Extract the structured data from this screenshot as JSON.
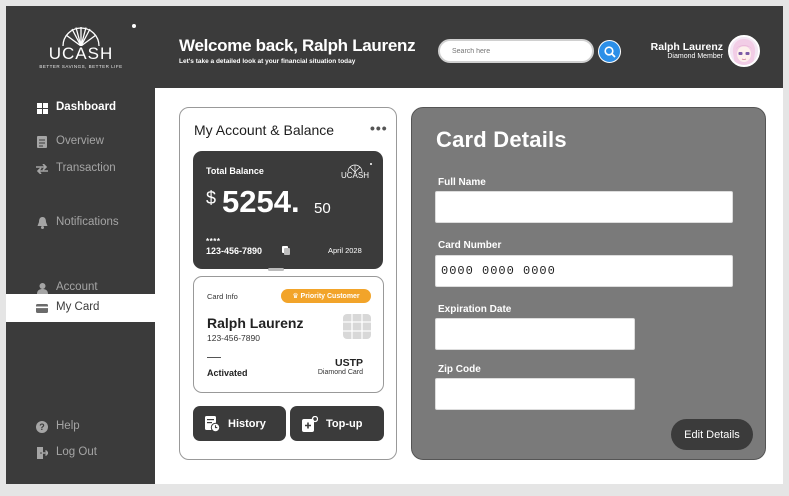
{
  "brand": {
    "name": "UCASH",
    "tagline": "BETTER SAVINGS, BETTER LIFE"
  },
  "sidebar": {
    "items": [
      {
        "label": "Dashboard",
        "icon": "grid-icon"
      },
      {
        "label": "Overview",
        "icon": "document-icon"
      },
      {
        "label": "Transaction",
        "icon": "transfer-icon"
      },
      {
        "label": "Notifications",
        "icon": "bell-icon"
      },
      {
        "label": "Account",
        "icon": "user-icon"
      },
      {
        "label": "My Card",
        "icon": "card-icon"
      },
      {
        "label": "Help",
        "icon": "question-icon"
      },
      {
        "label": "Log Out",
        "icon": "logout-icon"
      }
    ],
    "active": "My Card"
  },
  "header": {
    "welcome": "Welcome back, Ralph Laurenz",
    "subtitle": "Let's take a detailed look at your financial situation today",
    "search_placeholder": "Search here",
    "user_name": "Ralph Laurenz",
    "user_role": "Diamond Member"
  },
  "account": {
    "title": "My Account & Balance",
    "more": "•••",
    "balance_label": "Total Balance",
    "currency": "$",
    "balance_int": "5254.",
    "balance_dec": "50",
    "masked": "****",
    "account_number": "123-456-7890",
    "date": "April 2028",
    "mini_logo": "UCASH",
    "card_info_label": "Card Info",
    "badge": "♛ Priority Customer",
    "holder": "Ralph Laurenz",
    "holder_number": "123-456-7890",
    "status": "Activated",
    "bank": "USTP",
    "tier": "Diamond Card",
    "history_label": "History",
    "topup_label": "Top-up"
  },
  "card_details": {
    "title": "Card Details",
    "full_name_label": "Full Name",
    "full_name_value": "",
    "card_number_label": "Card Number",
    "card_number_value": "0000 0000 0000",
    "expiration_label": "Expiration Date",
    "expiration_value": "",
    "zip_label": "Zip Code",
    "zip_value": "",
    "edit_label": "Edit Details"
  },
  "colors": {
    "dark": "#3b3b3b",
    "panel": "#7a7a7a",
    "accent": "#2c8fe8",
    "badge": "#f2a42a"
  }
}
